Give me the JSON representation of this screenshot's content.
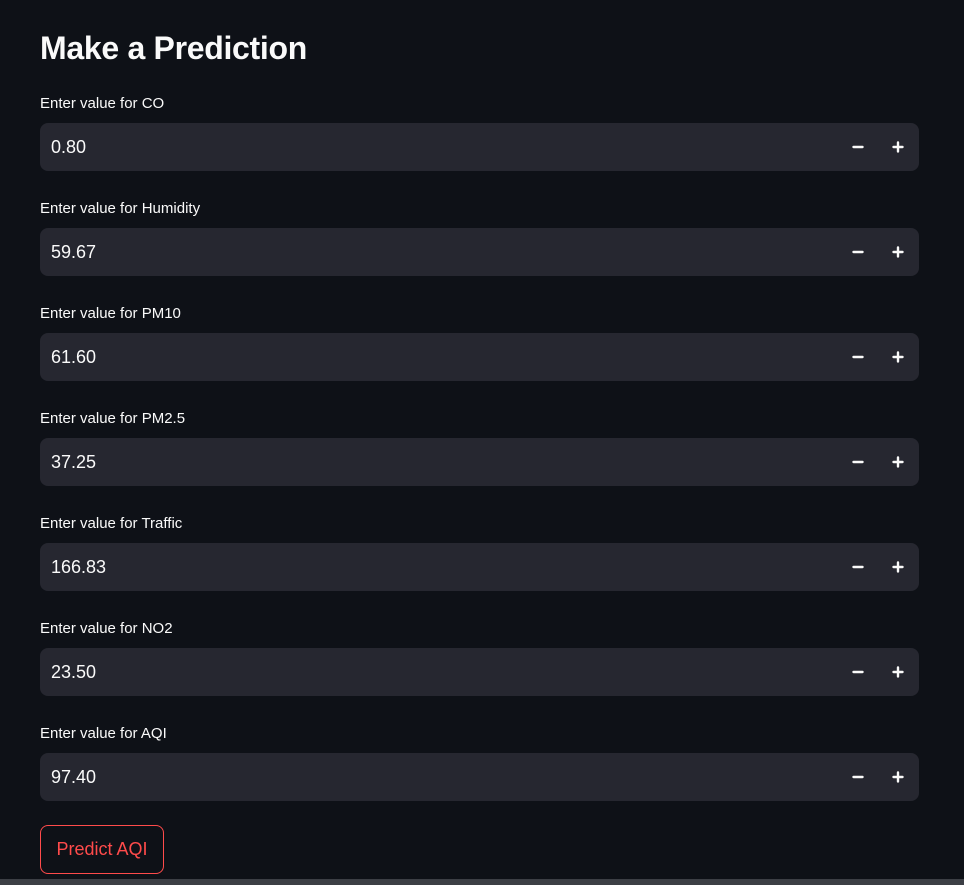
{
  "page": {
    "title": "Make a Prediction"
  },
  "fields": [
    {
      "label": "Enter value for CO",
      "value": "0.80"
    },
    {
      "label": "Enter value for Humidity",
      "value": "59.67"
    },
    {
      "label": "Enter value for PM10",
      "value": "61.60"
    },
    {
      "label": "Enter value for PM2.5",
      "value": "37.25"
    },
    {
      "label": "Enter value for Traffic",
      "value": "166.83"
    },
    {
      "label": "Enter value for NO2",
      "value": "23.50"
    },
    {
      "label": "Enter value for AQI",
      "value": "97.40"
    }
  ],
  "icons": {
    "decrement": "minus-icon",
    "increment": "plus-icon"
  },
  "actions": {
    "predict_label": "Predict AQI"
  },
  "colors": {
    "background": "#0e1117",
    "input_background": "#262730",
    "text": "#fafafa",
    "accent": "#ff4b4b"
  }
}
